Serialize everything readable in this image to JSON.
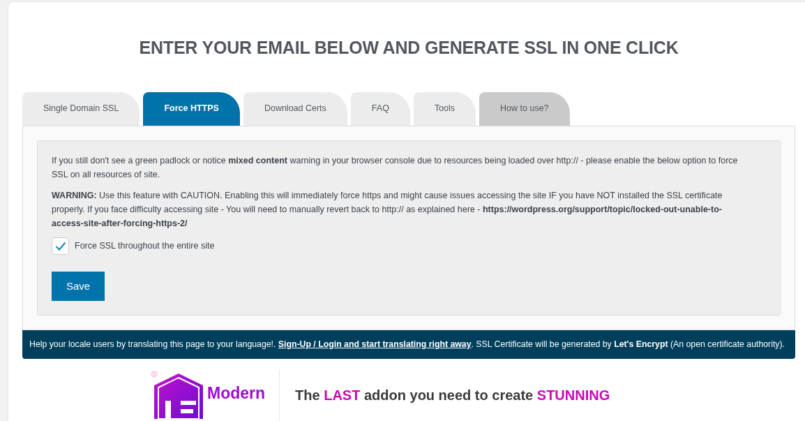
{
  "heading": "ENTER YOUR EMAIL BELOW AND GENERATE SSL IN ONE CLICK",
  "tabs": [
    {
      "label": "Single Domain SSL",
      "selected": false,
      "kind": "normal"
    },
    {
      "label": "Force HTTPS",
      "selected": true,
      "kind": "normal"
    },
    {
      "label": "Download Certs",
      "selected": false,
      "kind": "normal"
    },
    {
      "label": "FAQ",
      "selected": false,
      "kind": "normal"
    },
    {
      "label": "Tools",
      "selected": false,
      "kind": "normal"
    },
    {
      "label": "How to use?",
      "selected": false,
      "kind": "help"
    }
  ],
  "panel": {
    "paragraphs": [
      "If you still don't see a green padlock or notice **mixed content** warning in your browser console due to resources being loaded over http:// - please enable the below option to force SSL on all resources of site.",
      "**WARNING:** Use this feature with CAUTION. Enabling this will immediately force https and might cause issues accessing the site IF you have NOT installed the SSL certificate properly. If you face difficulty accessing site - You will need to manually revert back to http:// as explained here - **https://wordpress.org/support/topic/locked-out-unable-to-access-site-after-forcing-https-2/**"
    ],
    "checkbox": {
      "label": "Force SSL throughout the entire site",
      "checked": true
    },
    "button": "Save"
  },
  "footer": [
    {
      "kind": "text",
      "text": "Help your locale users by translating this page to your language!. "
    },
    {
      "kind": "link",
      "text": "Sign-Up / Login and start translating right away"
    },
    {
      "kind": "text",
      "text": ". SSL Certificate will be generated by **Let's Encrypt** (An open certificate authority)."
    }
  ],
  "promo": {
    "brand": [
      "Modern"
    ],
    "headline": [
      [
        {
          "text": "The ",
          "highlight": false
        },
        {
          "text": "LAST",
          "highlight": true
        },
        {
          "text": " addon you need to create ",
          "highlight": false
        },
        {
          "text": "STUNNING",
          "highlight": true
        }
      ]
    ]
  }
}
